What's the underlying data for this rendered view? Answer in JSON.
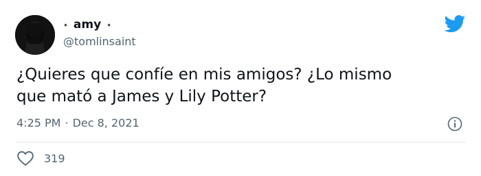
{
  "tweet": {
    "display_name": "amy",
    "name_decoration": "⋆",
    "handle": "@tomlinsaint",
    "text_line1": "¿Quieres que confíe en mis amigos? ¿Lo mismo",
    "text_line2": "que mató a James y Lily Potter?",
    "time": "4:25 PM",
    "separator": "·",
    "date": "Dec 8, 2021",
    "like_count": "319"
  },
  "icons": {
    "brand": "twitter-bird-icon",
    "info": "info-icon",
    "like": "heart-icon"
  },
  "colors": {
    "twitter_blue": "#1d9bf0",
    "secondary_text": "#536471",
    "primary_text": "#0f1419",
    "divider": "#e1e8ed"
  }
}
